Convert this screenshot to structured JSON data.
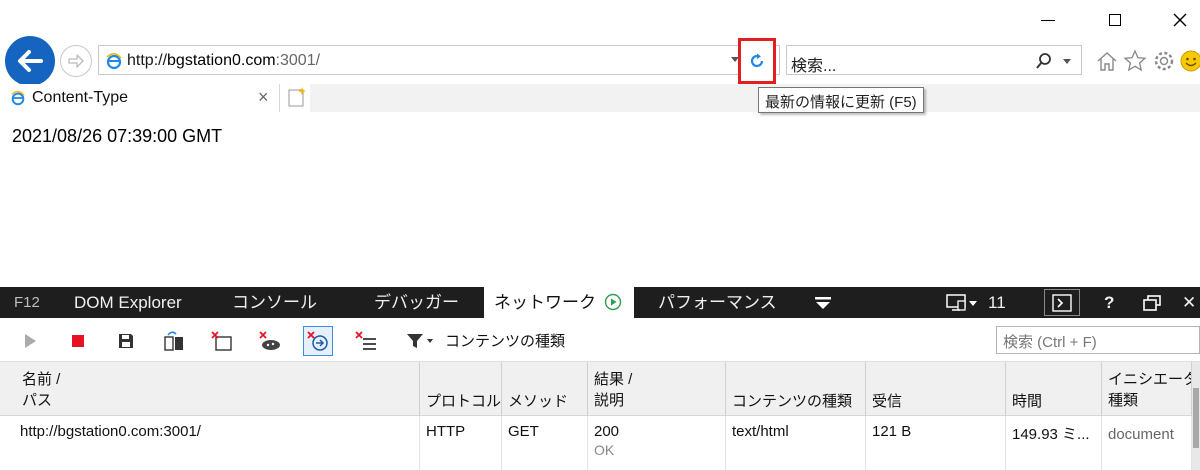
{
  "browser": {
    "address_url": "http://bgstation0.com:3001/",
    "address_url_prefix": "http://",
    "address_url_host": "bgstation0.com",
    "address_url_suffix": ":3001/",
    "search_placeholder": "検索...",
    "tab_title": "Content-Type",
    "tab_close": "×",
    "refresh_tooltip": "最新の情報に更新 (F5)",
    "accent_color": "#1565c0",
    "highlight_color": "#e02020"
  },
  "page": {
    "date_text": "2021/08/26 07:39:00 GMT"
  },
  "devtools": {
    "tabs": {
      "f12": "F12",
      "dom_explorer": "DOM Explorer",
      "console": "コンソール",
      "debugger": "デバッガー",
      "network": "ネットワーク",
      "performance": "パフォーマンス"
    },
    "emulation_count": "11",
    "help": "?",
    "close": "✕",
    "filter_label": "コンテンツの種類",
    "search_placeholder": "検索 (Ctrl + F)",
    "columns": {
      "name_l1": "名前 /",
      "name_l2": "パス",
      "protocol": "プロトコル",
      "method": "メソッド",
      "result_l1": "結果 /",
      "result_l2": "説明",
      "content_type": "コンテンツの種類",
      "received": "受信",
      "time": "時間",
      "initiator_l1": "イニシエーター",
      "initiator_l2": "種類"
    },
    "rows": [
      {
        "name": "http://bgstation0.com:3001/",
        "protocol": "HTTP",
        "method": "GET",
        "result": "200",
        "result_desc": "OK",
        "content_type": "text/html",
        "received": "121 B",
        "time": "149.93 ミ...",
        "initiator": "document"
      }
    ]
  }
}
